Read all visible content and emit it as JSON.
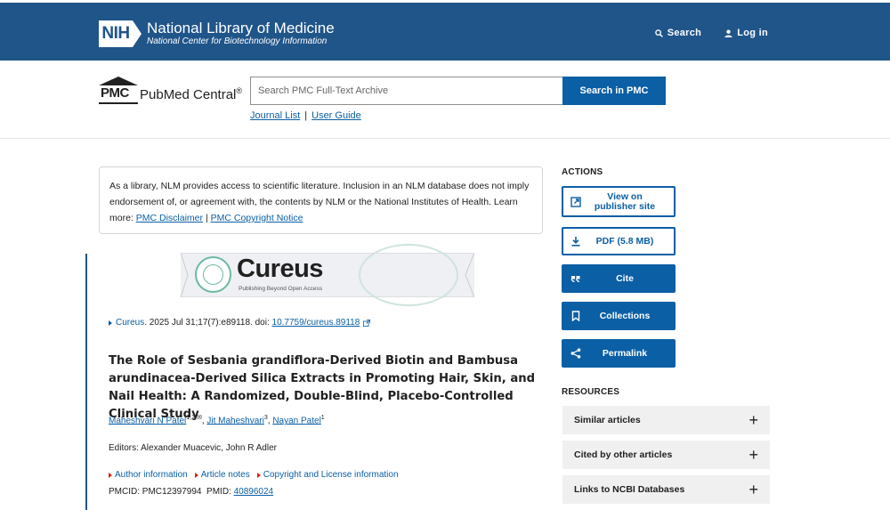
{
  "nih_header": {
    "badge": "NIH",
    "title": "National Library of Medicine",
    "subtitle": "National Center for Biotechnology Information",
    "search_label": "Search",
    "login_label": "Log in"
  },
  "pmc_header": {
    "logo_mark": "PMC",
    "logo_name": "PubMed Central",
    "logo_reg": "®",
    "search_placeholder": "Search PMC Full-Text Archive",
    "search_button": "Search in PMC",
    "journal_list": "Journal List",
    "separator": "|",
    "user_guide": "User Guide"
  },
  "disclaimer": {
    "text": "As a library, NLM provides access to scientific literature. Inclusion in an NLM database does not imply endorsement of, or agreement with, the contents by NLM or the National Institutes of Health.",
    "learn_more": "Learn more:",
    "link1": "PMC Disclaimer",
    "sep": "|",
    "link2": "PMC Copyright Notice"
  },
  "banner": {
    "name": "Cureus",
    "tagline": "Publishing Beyond Open Access"
  },
  "citation": {
    "journal": "Cureus",
    "details": ". 2025 Jul 31;17(7):e89118. doi: ",
    "doi": "10.7759/cureus.89118"
  },
  "article": {
    "title": "The Role of Sesbania grandiflora-Derived Biotin and Bambusa arundinacea-Derived Silica Extracts in Promoting Hair, Skin, and Nail Health: A Randomized, Double-Blind, Placebo-Controlled Clinical Study",
    "authors": [
      {
        "name": "Maheshvari N Patel",
        "sup": "1,2,✉",
        "sep": ", "
      },
      {
        "name": "Jit Maheshvari",
        "sup": "3",
        "sep": ", "
      },
      {
        "name": "Nayan Patel",
        "sup": "1",
        "sep": ""
      }
    ],
    "editors": "Editors: Alexander Muacevic, John R Adler",
    "info_links": [
      "Author information",
      "Article notes",
      "Copyright and License information"
    ],
    "pmcid_label": "PMCID: PMC12397994  PMID: ",
    "pmid": "40896024"
  },
  "sidebar": {
    "actions_heading": "ACTIONS",
    "view_publisher_line1": "View on",
    "view_publisher_line2": "publisher site",
    "pdf": "PDF (5.8 MB)",
    "cite": "Cite",
    "collections": "Collections",
    "permalink": "Permalink",
    "resources_heading": "RESOURCES",
    "resources": [
      "Similar articles",
      "Cited by other articles",
      "Links to NCBI Databases"
    ],
    "plus": "+"
  },
  "colors": {
    "nih_blue": "#20558a",
    "link_blue": "#0b5fa5",
    "resource_bg": "#f0f0f0",
    "info_arrow_red": "#d9230f"
  }
}
